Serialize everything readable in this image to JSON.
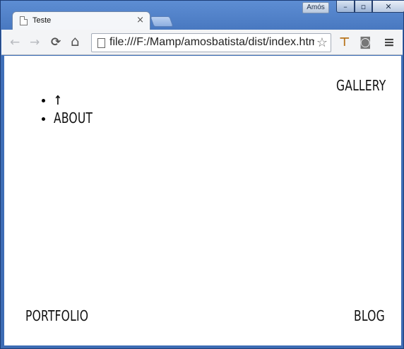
{
  "browser": {
    "profile_name": "Amós",
    "tab_title": "Teste",
    "tab_close": "×",
    "url": "file:///F:/Mamp/amosbatista/dist/index.html",
    "window_buttons": {
      "minimize": "–",
      "maximize": "▫",
      "close": "✕"
    }
  },
  "toolbar": {
    "back_icon": "←",
    "forward_icon": "→",
    "reload_icon": "⟳",
    "home_icon": "⌂",
    "star_icon": "☆",
    "extension_icon": "⊤",
    "camera_icon": "◙",
    "menu_icon": "≡"
  },
  "page": {
    "nav": [
      {
        "label": "↑",
        "icon": "up-arrow-icon"
      },
      {
        "label": "ABOUT"
      }
    ],
    "gallery": "GALLERY",
    "portfolio": "PORTFOLIO",
    "blog": "BLOG"
  }
}
